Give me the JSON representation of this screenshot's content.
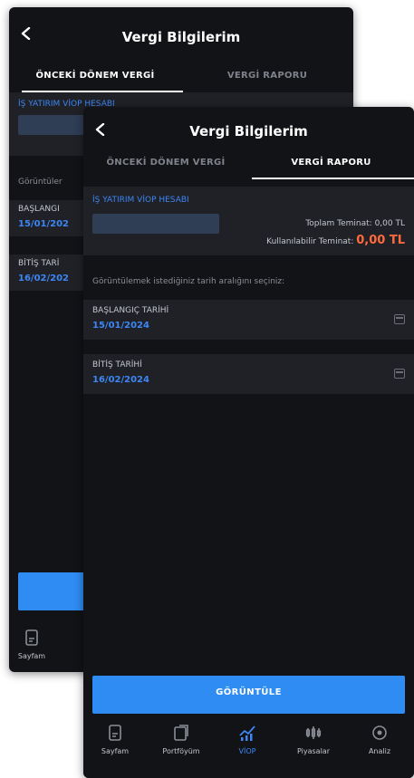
{
  "back_screen": {
    "title": "Vergi Bilgilerim",
    "tabs": [
      {
        "label": "ÖNCEKİ DÖNEM VERGİ",
        "active": true
      },
      {
        "label": "VERGİ RAPORU",
        "active": false
      }
    ],
    "account_label": "İŞ YATIRIM VİOP HESABI",
    "prompt": "Görüntüler",
    "start_label": "BAŞLANGI",
    "start_value": "15/01/202",
    "end_label": "BİTİŞ TARİ",
    "end_value": "16/02/202",
    "nav_label": "Sayfam"
  },
  "front_screen": {
    "title": "Vergi Bilgilerim",
    "tabs": [
      {
        "label": "ÖNCEKİ DÖNEM VERGİ",
        "active": false
      },
      {
        "label": "VERGİ RAPORU",
        "active": true
      }
    ],
    "account_label": "İŞ YATIRIM VİOP HESABI",
    "collateral_label": "Toplam Teminat:",
    "collateral_value": "0,00 TL",
    "usable_label": "Kullanılabilir Teminat:",
    "usable_value": "0,00 TL",
    "prompt": "Görüntülemek istediğiniz tarih aralığını seçiniz:",
    "start_label": "BAŞLANGIÇ TARİHİ",
    "start_value": "15/01/2024",
    "end_label": "BİTİŞ TARİHİ",
    "end_value": "16/02/2024",
    "submit_label": "GÖRÜNTÜLE",
    "nav": [
      {
        "label": "Sayfam",
        "icon": "page-icon",
        "active": false
      },
      {
        "label": "Portföyüm",
        "icon": "portfolio-icon",
        "active": false
      },
      {
        "label": "VİOP",
        "icon": "chart-icon",
        "active": true
      },
      {
        "label": "Piyasalar",
        "icon": "markets-icon",
        "active": false
      },
      {
        "label": "Analiz",
        "icon": "analysis-icon",
        "active": false
      }
    ]
  },
  "colors": {
    "background": "#121317",
    "card": "#1f2127",
    "accent_blue": "#2f8cf3",
    "link_blue": "#3d86f3",
    "negative_orange": "#ff6a3d"
  }
}
